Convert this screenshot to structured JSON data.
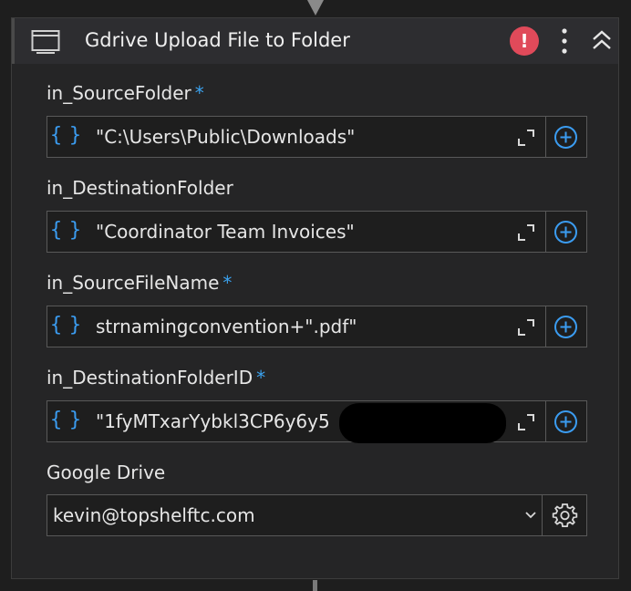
{
  "activity": {
    "title": "Gdrive Upload File to Folder",
    "icon": "screen-icon",
    "error_symbol": "!",
    "colors": {
      "error": "#e04a5a",
      "accent": "#3ba3f0"
    }
  },
  "fields": [
    {
      "label": "in_SourceFolder",
      "required": "*",
      "value": "\"C:\\Users\\Public\\Downloads\"",
      "expr_symbol": "{ }"
    },
    {
      "label": "in_DestinationFolder",
      "required": "",
      "value": "\"Coordinator Team Invoices\"",
      "expr_symbol": "{ }"
    },
    {
      "label": "in_SourceFileName",
      "required": "*",
      "value": "strnamingconvention+\".pdf\"",
      "expr_symbol": "{ }"
    },
    {
      "label": "in_DestinationFolderID",
      "required": "*",
      "value": "\"1fyMTxarYybkl3CP6y6y5",
      "expr_symbol": "{ }"
    }
  ],
  "google_drive": {
    "label": "Google Drive",
    "selected": "kevin@topshelftc.com"
  }
}
